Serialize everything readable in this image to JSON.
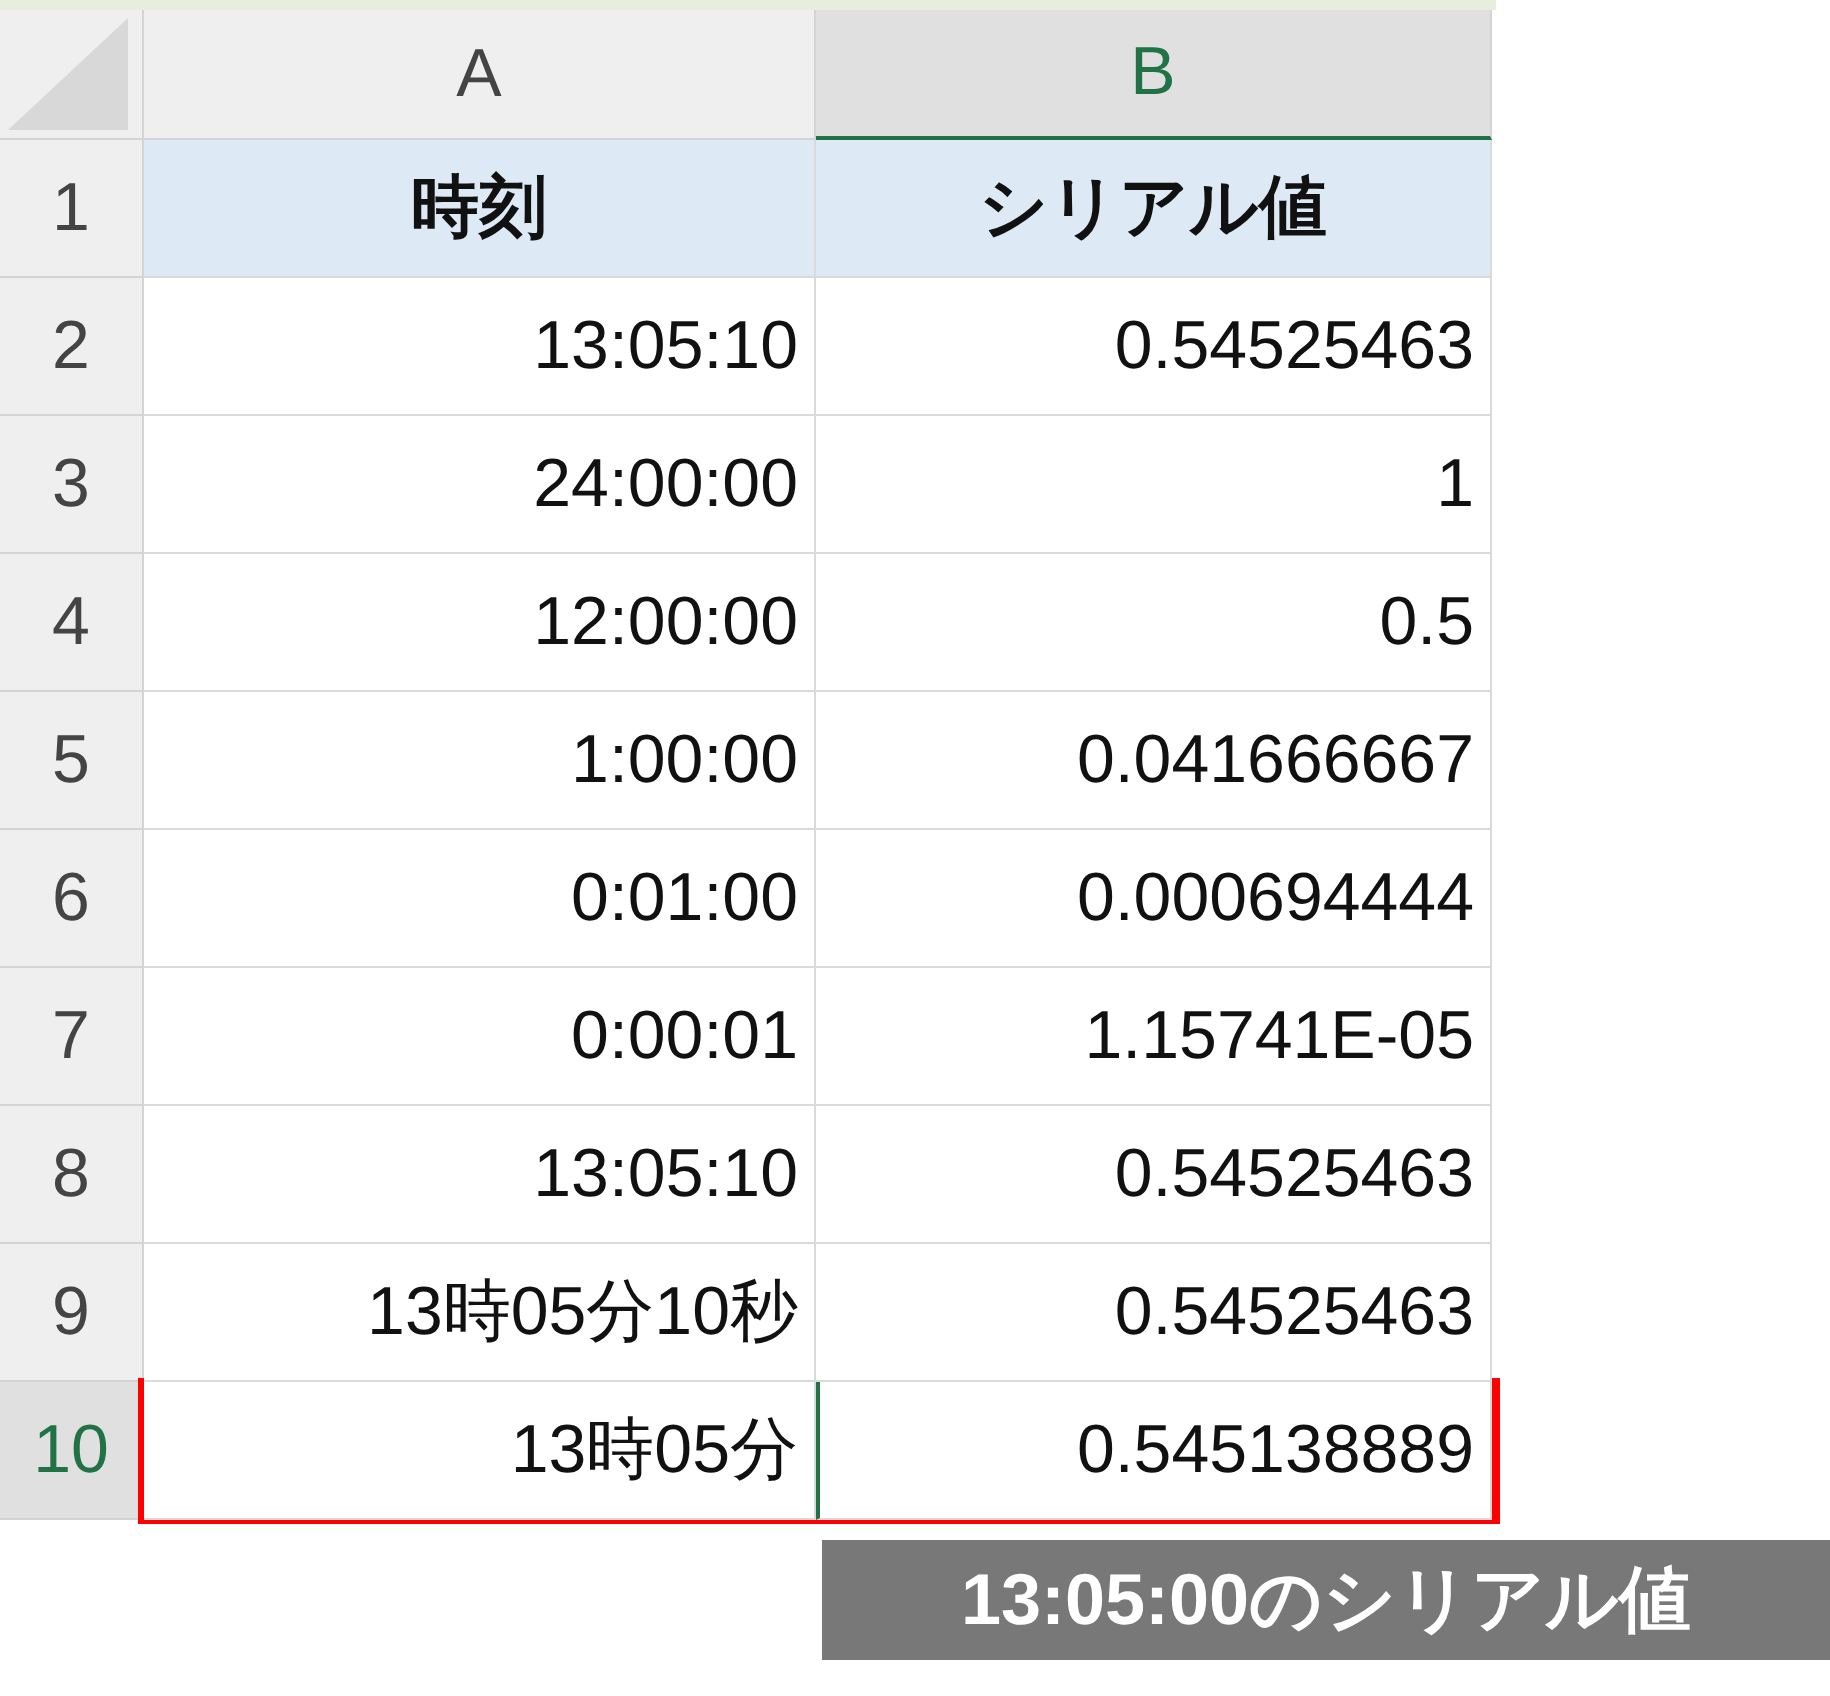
{
  "columns": [
    {
      "label": "A",
      "selected": false
    },
    {
      "label": "B",
      "selected": true
    }
  ],
  "rows": [
    {
      "number": "1",
      "selected": false,
      "highlighted": false,
      "kind": "header",
      "cells": [
        "時刻",
        "シリアル値"
      ]
    },
    {
      "number": "2",
      "selected": false,
      "highlighted": false,
      "kind": "data",
      "cells": [
        "13:05:10",
        "0.54525463"
      ]
    },
    {
      "number": "3",
      "selected": false,
      "highlighted": false,
      "kind": "data",
      "cells": [
        "24:00:00",
        "1"
      ]
    },
    {
      "number": "4",
      "selected": false,
      "highlighted": false,
      "kind": "data",
      "cells": [
        "12:00:00",
        "0.5"
      ]
    },
    {
      "number": "5",
      "selected": false,
      "highlighted": false,
      "kind": "data",
      "cells": [
        "1:00:00",
        "0.041666667"
      ]
    },
    {
      "number": "6",
      "selected": false,
      "highlighted": false,
      "kind": "data",
      "cells": [
        "0:01:00",
        "0.000694444"
      ]
    },
    {
      "number": "7",
      "selected": false,
      "highlighted": false,
      "kind": "data",
      "cells": [
        "0:00:01",
        "1.15741E-05"
      ]
    },
    {
      "number": "8",
      "selected": false,
      "highlighted": false,
      "kind": "data",
      "cells": [
        "13:05:10",
        "0.54525463"
      ]
    },
    {
      "number": "9",
      "selected": false,
      "highlighted": false,
      "kind": "data",
      "cells": [
        "13時05分10秒",
        "0.54525463"
      ]
    },
    {
      "number": "10",
      "selected": true,
      "highlighted": true,
      "kind": "data",
      "cells": [
        "13時05分",
        "0.545138889"
      ]
    }
  ],
  "callout": "13:05:00のシリアル値"
}
